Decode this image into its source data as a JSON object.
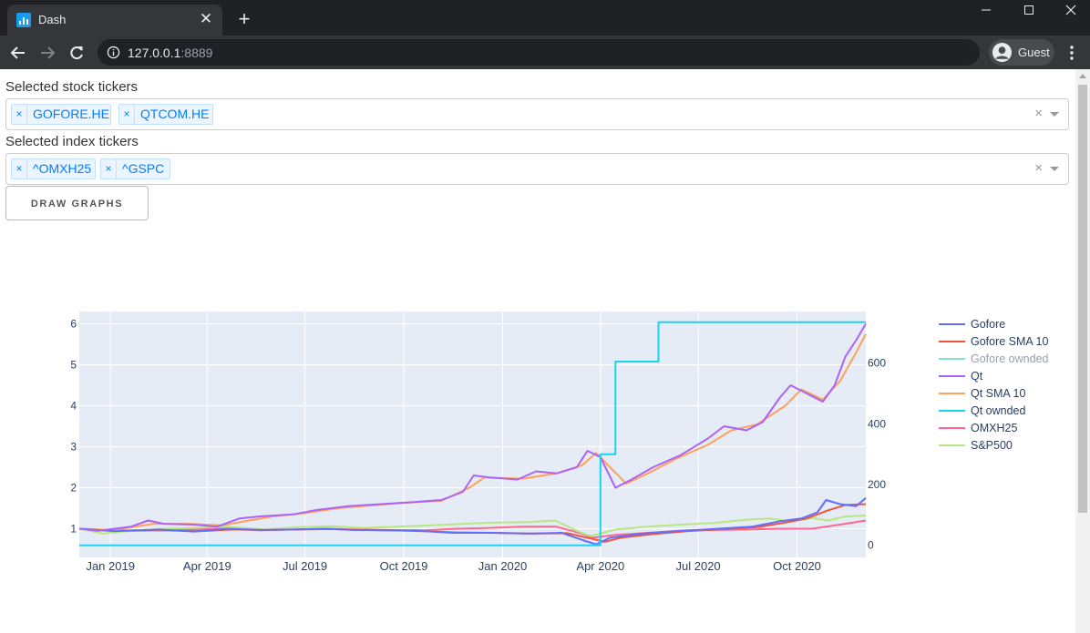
{
  "browser": {
    "tab_title": "Dash",
    "url_host": "127.0.0.1",
    "url_port": ":8889",
    "profile_name": "Guest"
  },
  "icons": {
    "tab_favicon": "bar-chart-favicon",
    "close": "close-icon",
    "new_tab": "plus-icon",
    "back": "arrow-left-icon",
    "forward": "arrow-right-icon",
    "reload": "reload-icon",
    "info": "info-circle-icon",
    "profile": "user-avatar-icon",
    "menu": "kebab-menu-icon"
  },
  "form": {
    "stock_label": "Selected stock tickers",
    "stock_tickers": [
      "GOFORE.HE",
      "QTCOM.HE"
    ],
    "index_label": "Selected index tickers",
    "index_tickers": [
      "^OMXH25",
      "^GSPC"
    ],
    "remove_symbol": "×",
    "clear_symbol": "×",
    "draw_button": "DRAW GRAPHS"
  },
  "chart_data": {
    "type": "line",
    "title": "",
    "x_tick_labels": [
      "Jan 2019",
      "Apr 2019",
      "Jul 2019",
      "Oct 2019",
      "Jan 2020",
      "Apr 2020",
      "Jul 2020",
      "Oct 2020"
    ],
    "x_tick_dates": [
      "2019-01-01",
      "2019-04-01",
      "2019-07-01",
      "2019-10-01",
      "2020-01-01",
      "2020-04-01",
      "2020-07-01",
      "2020-10-01"
    ],
    "xlim": [
      "2018-12-03",
      "2020-12-04"
    ],
    "y_left": {
      "ticks": [
        1,
        2,
        3,
        4,
        5,
        6
      ],
      "ylim": [
        0.3,
        6.3
      ]
    },
    "y_right": {
      "ticks": [
        0,
        200,
        400,
        600
      ],
      "ylim": [
        -40,
        770
      ]
    },
    "legend_position": "right",
    "background": "#e5ecf6",
    "series": [
      {
        "name": "Gofore",
        "color": "#636efa",
        "axis": "left",
        "legend_dimmed": false,
        "points": [
          [
            "2018-12-03",
            1.0
          ],
          [
            "2019-01-05",
            0.94
          ],
          [
            "2019-02-15",
            0.98
          ],
          [
            "2019-03-20",
            0.93
          ],
          [
            "2019-04-20",
            1.0
          ],
          [
            "2019-05-20",
            0.97
          ],
          [
            "2019-06-20",
            0.98
          ],
          [
            "2019-07-20",
            1.0
          ],
          [
            "2019-08-15",
            0.97
          ],
          [
            "2019-09-15",
            0.96
          ],
          [
            "2019-10-15",
            0.95
          ],
          [
            "2019-11-15",
            0.9
          ],
          [
            "2019-12-20",
            0.9
          ],
          [
            "2020-01-25",
            0.88
          ],
          [
            "2020-02-25",
            0.9
          ],
          [
            "2020-03-18",
            0.7
          ],
          [
            "2020-03-28",
            0.62
          ],
          [
            "2020-04-10",
            0.78
          ],
          [
            "2020-05-10",
            0.88
          ],
          [
            "2020-06-15",
            0.95
          ],
          [
            "2020-07-20",
            1.0
          ],
          [
            "2020-08-20",
            1.05
          ],
          [
            "2020-09-15",
            1.18
          ],
          [
            "2020-10-05",
            1.25
          ],
          [
            "2020-10-20",
            1.4
          ],
          [
            "2020-10-28",
            1.7
          ],
          [
            "2020-11-10",
            1.6
          ],
          [
            "2020-11-25",
            1.55
          ],
          [
            "2020-12-04",
            1.75
          ]
        ]
      },
      {
        "name": "Gofore SMA 10",
        "color": "#ef553b",
        "axis": "left",
        "legend_dimmed": false,
        "points": [
          [
            "2018-12-03",
            1.0
          ],
          [
            "2019-01-10",
            0.95
          ],
          [
            "2019-02-20",
            0.96
          ],
          [
            "2019-03-25",
            0.94
          ],
          [
            "2019-04-25",
            0.98
          ],
          [
            "2019-05-25",
            0.97
          ],
          [
            "2019-06-25",
            0.98
          ],
          [
            "2019-07-25",
            0.99
          ],
          [
            "2019-08-20",
            0.97
          ],
          [
            "2019-09-20",
            0.96
          ],
          [
            "2019-10-20",
            0.94
          ],
          [
            "2019-11-20",
            0.91
          ],
          [
            "2019-12-25",
            0.9
          ],
          [
            "2020-01-30",
            0.88
          ],
          [
            "2020-03-01",
            0.89
          ],
          [
            "2020-03-25",
            0.75
          ],
          [
            "2020-04-05",
            0.68
          ],
          [
            "2020-04-20",
            0.78
          ],
          [
            "2020-05-20",
            0.87
          ],
          [
            "2020-06-20",
            0.94
          ],
          [
            "2020-07-25",
            0.99
          ],
          [
            "2020-08-25",
            1.04
          ],
          [
            "2020-09-20",
            1.15
          ],
          [
            "2020-10-10",
            1.25
          ],
          [
            "2020-10-30",
            1.45
          ],
          [
            "2020-11-15",
            1.58
          ],
          [
            "2020-12-04",
            1.6
          ]
        ]
      },
      {
        "name": "Gofore ownded",
        "color": "#00cc96",
        "axis": "right",
        "legend_dimmed": true,
        "points": []
      },
      {
        "name": "Qt",
        "color": "#ab63fa",
        "axis": "left",
        "legend_dimmed": false,
        "points": [
          [
            "2018-12-03",
            1.0
          ],
          [
            "2018-12-20",
            0.95
          ],
          [
            "2019-01-20",
            1.05
          ],
          [
            "2019-02-05",
            1.2
          ],
          [
            "2019-02-20",
            1.12
          ],
          [
            "2019-03-20",
            1.1
          ],
          [
            "2019-04-10",
            1.05
          ],
          [
            "2019-05-01",
            1.25
          ],
          [
            "2019-05-20",
            1.3
          ],
          [
            "2019-06-20",
            1.35
          ],
          [
            "2019-07-10",
            1.45
          ],
          [
            "2019-08-10",
            1.55
          ],
          [
            "2019-09-10",
            1.6
          ],
          [
            "2019-10-10",
            1.65
          ],
          [
            "2019-11-05",
            1.7
          ],
          [
            "2019-11-25",
            1.9
          ],
          [
            "2019-12-05",
            2.3
          ],
          [
            "2019-12-20",
            2.25
          ],
          [
            "2020-01-15",
            2.2
          ],
          [
            "2020-02-01",
            2.4
          ],
          [
            "2020-02-20",
            2.35
          ],
          [
            "2020-03-10",
            2.5
          ],
          [
            "2020-03-20",
            2.9
          ],
          [
            "2020-04-01",
            2.75
          ],
          [
            "2020-04-15",
            2.0
          ],
          [
            "2020-04-30",
            2.2
          ],
          [
            "2020-05-20",
            2.5
          ],
          [
            "2020-06-15",
            2.8
          ],
          [
            "2020-07-10",
            3.2
          ],
          [
            "2020-07-25",
            3.5
          ],
          [
            "2020-08-15",
            3.4
          ],
          [
            "2020-08-30",
            3.6
          ],
          [
            "2020-09-15",
            4.2
          ],
          [
            "2020-09-25",
            4.5
          ],
          [
            "2020-10-10",
            4.3
          ],
          [
            "2020-10-25",
            4.1
          ],
          [
            "2020-11-05",
            4.5
          ],
          [
            "2020-11-15",
            5.2
          ],
          [
            "2020-11-25",
            5.6
          ],
          [
            "2020-12-04",
            6.0
          ]
        ]
      },
      {
        "name": "Qt SMA 10",
        "color": "#ffa15a",
        "axis": "left",
        "legend_dimmed": false,
        "points": [
          [
            "2018-12-03",
            1.0
          ],
          [
            "2019-01-05",
            0.97
          ],
          [
            "2019-02-10",
            1.12
          ],
          [
            "2019-03-15",
            1.12
          ],
          [
            "2019-04-15",
            1.08
          ],
          [
            "2019-05-10",
            1.2
          ],
          [
            "2019-06-01",
            1.3
          ],
          [
            "2019-07-01",
            1.38
          ],
          [
            "2019-08-01",
            1.5
          ],
          [
            "2019-09-01",
            1.57
          ],
          [
            "2019-10-01",
            1.63
          ],
          [
            "2019-11-05",
            1.68
          ],
          [
            "2019-12-01",
            2.0
          ],
          [
            "2019-12-15",
            2.25
          ],
          [
            "2020-01-20",
            2.22
          ],
          [
            "2020-02-20",
            2.35
          ],
          [
            "2020-03-15",
            2.55
          ],
          [
            "2020-03-28",
            2.85
          ],
          [
            "2020-04-10",
            2.5
          ],
          [
            "2020-04-25",
            2.1
          ],
          [
            "2020-05-15",
            2.35
          ],
          [
            "2020-06-10",
            2.7
          ],
          [
            "2020-07-10",
            3.05
          ],
          [
            "2020-08-01",
            3.4
          ],
          [
            "2020-08-25",
            3.55
          ],
          [
            "2020-09-20",
            4.0
          ],
          [
            "2020-10-05",
            4.4
          ],
          [
            "2020-10-25",
            4.15
          ],
          [
            "2020-11-10",
            4.6
          ],
          [
            "2020-11-25",
            5.3
          ],
          [
            "2020-12-04",
            5.75
          ]
        ]
      },
      {
        "name": "Qt ownded",
        "color": "#19d3f3",
        "axis": "right",
        "legend_dimmed": false,
        "points": [
          [
            "2018-12-03",
            0
          ],
          [
            "2020-03-25",
            0
          ],
          [
            "2020-04-01",
            0
          ],
          [
            "2020-04-01",
            300
          ],
          [
            "2020-04-15",
            300
          ],
          [
            "2020-04-15",
            605
          ],
          [
            "2020-05-25",
            605
          ],
          [
            "2020-05-25",
            735
          ],
          [
            "2020-12-04",
            735
          ]
        ]
      },
      {
        "name": "OMXH25",
        "color": "#ff6692",
        "axis": "left",
        "legend_dimmed": false,
        "points": [
          [
            "2018-12-03",
            1.0
          ],
          [
            "2019-01-10",
            0.95
          ],
          [
            "2019-02-15",
            0.98
          ],
          [
            "2019-03-15",
            0.98
          ],
          [
            "2019-04-15",
            1.0
          ],
          [
            "2019-05-20",
            0.96
          ],
          [
            "2019-06-20",
            0.98
          ],
          [
            "2019-07-20",
            1.0
          ],
          [
            "2019-08-20",
            0.98
          ],
          [
            "2019-09-20",
            0.97
          ],
          [
            "2019-10-20",
            0.96
          ],
          [
            "2019-11-20",
            1.0
          ],
          [
            "2019-12-20",
            1.02
          ],
          [
            "2020-01-20",
            1.05
          ],
          [
            "2020-02-20",
            1.05
          ],
          [
            "2020-03-15",
            0.88
          ],
          [
            "2020-03-25",
            0.78
          ],
          [
            "2020-04-15",
            0.85
          ],
          [
            "2020-05-15",
            0.9
          ],
          [
            "2020-06-15",
            0.95
          ],
          [
            "2020-07-15",
            0.97
          ],
          [
            "2020-08-15",
            0.98
          ],
          [
            "2020-09-15",
            1.0
          ],
          [
            "2020-10-15",
            1.0
          ],
          [
            "2020-11-10",
            1.1
          ],
          [
            "2020-12-04",
            1.2
          ]
        ]
      },
      {
        "name": "S&P500",
        "color": "#b6e880",
        "axis": "left",
        "legend_dimmed": false,
        "points": [
          [
            "2018-12-03",
            1.0
          ],
          [
            "2018-12-25",
            0.88
          ],
          [
            "2019-01-20",
            0.95
          ],
          [
            "2019-02-20",
            1.0
          ],
          [
            "2019-03-20",
            1.02
          ],
          [
            "2019-04-20",
            1.05
          ],
          [
            "2019-05-25",
            0.98
          ],
          [
            "2019-06-25",
            1.04
          ],
          [
            "2019-07-25",
            1.06
          ],
          [
            "2019-08-25",
            1.02
          ],
          [
            "2019-09-25",
            1.05
          ],
          [
            "2019-10-25",
            1.08
          ],
          [
            "2019-11-25",
            1.12
          ],
          [
            "2019-12-25",
            1.15
          ],
          [
            "2020-01-25",
            1.16
          ],
          [
            "2020-02-19",
            1.2
          ],
          [
            "2020-03-10",
            0.95
          ],
          [
            "2020-03-23",
            0.82
          ],
          [
            "2020-04-15",
            0.98
          ],
          [
            "2020-05-15",
            1.05
          ],
          [
            "2020-06-15",
            1.1
          ],
          [
            "2020-07-15",
            1.14
          ],
          [
            "2020-08-15",
            1.22
          ],
          [
            "2020-09-05",
            1.25
          ],
          [
            "2020-09-25",
            1.18
          ],
          [
            "2020-10-15",
            1.26
          ],
          [
            "2020-10-30",
            1.2
          ],
          [
            "2020-11-15",
            1.3
          ],
          [
            "2020-12-04",
            1.32
          ]
        ]
      }
    ]
  }
}
